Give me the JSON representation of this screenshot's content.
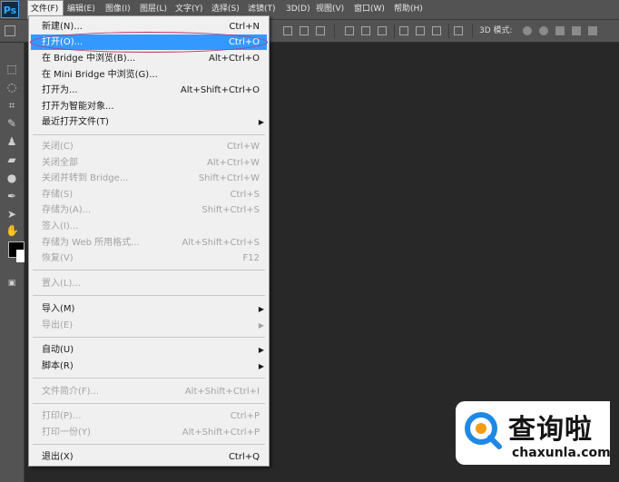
{
  "app": {
    "logo": "Ps"
  },
  "menubar": {
    "items": [
      {
        "label": "文件(F)"
      },
      {
        "label": "编辑(E)"
      },
      {
        "label": "图像(I)"
      },
      {
        "label": "图层(L)"
      },
      {
        "label": "文字(Y)"
      },
      {
        "label": "选择(S)"
      },
      {
        "label": "滤镜(T)"
      },
      {
        "label": "3D(D)"
      },
      {
        "label": "视图(V)"
      },
      {
        "label": "窗口(W)"
      },
      {
        "label": "帮助(H)"
      }
    ]
  },
  "options_bar": {
    "mode3d_label": "3D 模式:"
  },
  "file_menu": {
    "items": [
      {
        "label": "新建(N)...",
        "shortcut": "Ctrl+N"
      },
      {
        "label": "打开(O)...",
        "shortcut": "Ctrl+O"
      },
      {
        "label": "在 Bridge 中浏览(B)...",
        "shortcut": "Alt+Ctrl+O"
      },
      {
        "label": "在 Mini Bridge 中浏览(G)...",
        "shortcut": ""
      },
      {
        "label": "打开为...",
        "shortcut": "Alt+Shift+Ctrl+O"
      },
      {
        "label": "打开为智能对象...",
        "shortcut": ""
      },
      {
        "label": "最近打开文件(T)",
        "shortcut": ""
      },
      {
        "label": "关闭(C)",
        "shortcut": "Ctrl+W"
      },
      {
        "label": "关闭全部",
        "shortcut": "Alt+Ctrl+W"
      },
      {
        "label": "关闭并转到 Bridge...",
        "shortcut": "Shift+Ctrl+W"
      },
      {
        "label": "存储(S)",
        "shortcut": "Ctrl+S"
      },
      {
        "label": "存储为(A)...",
        "shortcut": "Shift+Ctrl+S"
      },
      {
        "label": "签入(I)...",
        "shortcut": ""
      },
      {
        "label": "存储为 Web 所用格式...",
        "shortcut": "Alt+Shift+Ctrl+S"
      },
      {
        "label": "恢复(V)",
        "shortcut": "F12"
      },
      {
        "label": "置入(L)...",
        "shortcut": ""
      },
      {
        "label": "导入(M)",
        "shortcut": ""
      },
      {
        "label": "导出(E)",
        "shortcut": ""
      },
      {
        "label": "自动(U)",
        "shortcut": ""
      },
      {
        "label": "脚本(R)",
        "shortcut": ""
      },
      {
        "label": "文件简介(F)...",
        "shortcut": "Alt+Shift+Ctrl+I"
      },
      {
        "label": "打印(P)...",
        "shortcut": "Ctrl+P"
      },
      {
        "label": "打印一份(Y)",
        "shortcut": "Alt+Shift+Ctrl+P"
      },
      {
        "label": "退出(X)",
        "shortcut": "Ctrl+Q"
      }
    ]
  },
  "watermark": {
    "cn": "查询啦",
    "en": "chaxunla.com"
  },
  "colors": {
    "highlight": "#3399ff",
    "annotation_circle": "#c0306e",
    "ps_accent": "#31a8ff"
  }
}
